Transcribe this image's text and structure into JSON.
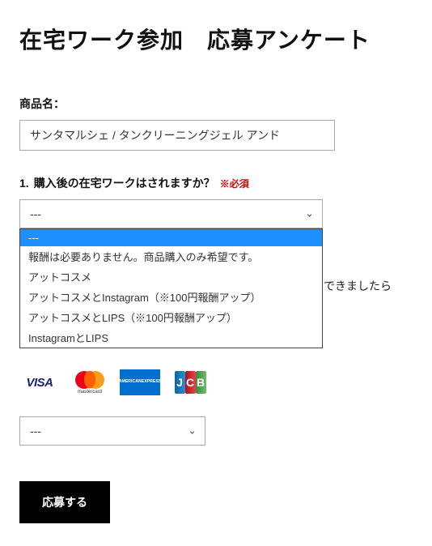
{
  "page_title": "在宅ワーク参加　応募アンケート",
  "product": {
    "label": "商品名：",
    "value": "サンタマルシェ / タンクリーニングジェル アンド"
  },
  "q1": {
    "number": "1.",
    "text": "購入後の在宅ワークはされますか？",
    "required_label": "※必須",
    "selected": "---",
    "options": [
      "---",
      "報酬は必要ありません。商品購入のみ希望です。",
      "アットコスメ",
      "アットコスメとInstagram（※100円報酬アップ）",
      "アットコスメとLIPS（※100円報酬アップ）",
      "InstagramとLIPS"
    ]
  },
  "partial_hidden_text": "できましたら",
  "cards": {
    "visa": "VISA",
    "mastercard_label": "mastercard",
    "amex_l1": "AMERICAN",
    "amex_l2": "EXPRESS",
    "jcb_j": "J",
    "jcb_c": "C",
    "jcb_b": "B"
  },
  "select2": {
    "selected": "---"
  },
  "submit_label": "応募する"
}
